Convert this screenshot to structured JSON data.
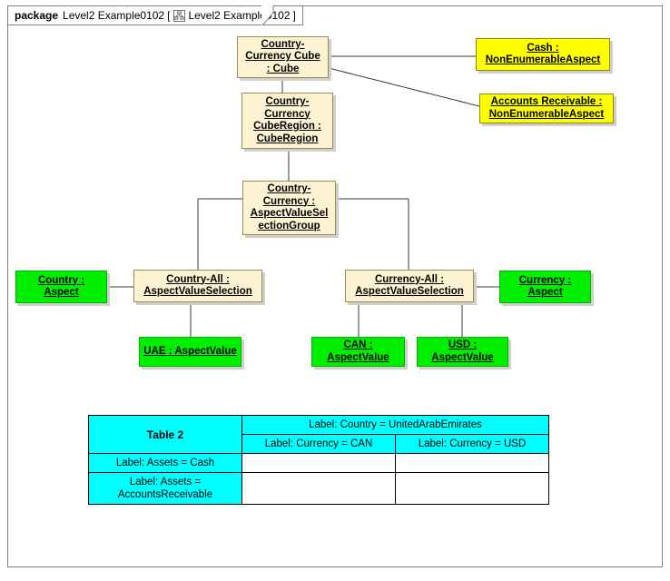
{
  "package": {
    "keyword": "package",
    "name": "Level2 Example0102",
    "bracket_open": "[",
    "bracket_close": "]",
    "frame_label": "Level2 Example0102",
    "icon": "class-diagram-icon"
  },
  "colors": {
    "cream": "#FDF3D3",
    "yellow": "#FFFF00",
    "green": "#00EE00",
    "cyan": "#00FFFF",
    "line": "#3A3A3A",
    "frame": "#808080",
    "shadow": "#CFCFCF"
  },
  "nodes": [
    {
      "id": "cube",
      "label": "Country-Currency Cube : Cube",
      "fill": "cream"
    },
    {
      "id": "cash",
      "label": "Cash : NonEnumerableAspect",
      "fill": "yellow"
    },
    {
      "id": "accounts",
      "label": "Accounts Receivable : NonEnumerableAspect",
      "fill": "yellow"
    },
    {
      "id": "cuberegion",
      "label": "Country-Currency CubeRegion : CubeRegion",
      "fill": "cream"
    },
    {
      "id": "avsgroup",
      "label": "Country-Currency : AspectValueSelectionGroup",
      "fill": "cream"
    },
    {
      "id": "country",
      "label": "Country : Aspect",
      "fill": "green"
    },
    {
      "id": "countryall",
      "label": "Country-All : AspectValueSelection",
      "fill": "cream"
    },
    {
      "id": "currencyall",
      "label": "Currency-All : AspectValueSelection",
      "fill": "cream"
    },
    {
      "id": "currency",
      "label": "Currency : Aspect",
      "fill": "green"
    },
    {
      "id": "uae",
      "label": "UAE : AspectValue",
      "fill": "green"
    },
    {
      "id": "can",
      "label": "CAN : AspectValue",
      "fill": "green"
    },
    {
      "id": "usd",
      "label": "USD : AspectValue",
      "fill": "green"
    }
  ],
  "node_text": {
    "cube_line1": "Country-",
    "cube_line2": "Currency Cube",
    "cube_line3": ": Cube",
    "cash_line1": "Cash :",
    "cash_line2": "NonEnumerableAspect",
    "accounts_line1": "Accounts Receivable :",
    "accounts_line2": "NonEnumerableAspect",
    "cuberegion_line1": "Country-",
    "cuberegion_line2": "Currency",
    "cuberegion_line3": "CubeRegion :",
    "cuberegion_line4": "CubeRegion",
    "avsgroup_line1": "Country-",
    "avsgroup_line2": "Currency :",
    "avsgroup_line3": "AspectValueSel",
    "avsgroup_line4": "ectionGroup",
    "country_line1": "Country :",
    "country_line2": "Aspect",
    "countryall_line1": "Country-All :",
    "countryall_line2": "AspectValueSelection",
    "currencyall_line1": "Currency-All :",
    "currencyall_line2": "AspectValueSelection",
    "currency_line1": "Currency :",
    "currency_line2": "Aspect",
    "uae_line1": "UAE : AspectValue",
    "can_line1": "CAN :",
    "can_line2": "AspectValue",
    "usd_line1": "USD :",
    "usd_line2": "AspectValue"
  },
  "table": {
    "title": "Table 2",
    "country_header": "Label: Country = UnitedArabEmirates",
    "currency_can": "Label: Currency = CAN",
    "currency_usd": "Label: Currency = USD",
    "row_cash": "Label: Assets = Cash",
    "row_ar_line1": "Label: Assets =",
    "row_ar_line2": "AccountsReceivable",
    "cells": [
      [
        "",
        ""
      ],
      [
        "",
        ""
      ]
    ]
  }
}
